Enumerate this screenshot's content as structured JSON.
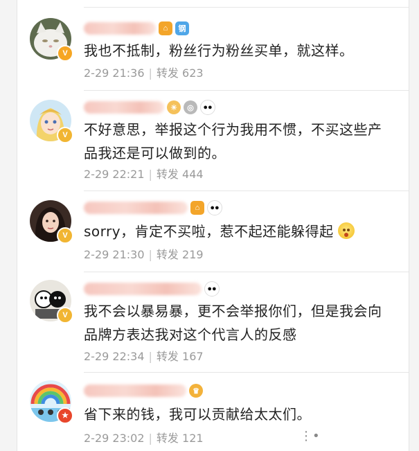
{
  "colors": {
    "verified_orange": "#f6a623",
    "verified_gold": "#f1b532",
    "verified_red": "#e8462b",
    "comment_text": "#222222",
    "meta_text": "#9a9a9a"
  },
  "comments": [
    {
      "avatar": "white-cat-avatar",
      "verified": "orange",
      "badges": [
        "home-badge-icon",
        "shield-badge-icon"
      ],
      "shield_text": "钢",
      "text": "我也不抵制，粉丝行为粉丝买单，就这样。",
      "date": "2-29 21:36",
      "repost_label": "转发",
      "repost_count": "623"
    },
    {
      "avatar": "anime-girl-avatar",
      "verified": "gold",
      "badges": [
        "sun-badge-icon",
        "medal-badge-icon",
        "panda-badge-icon"
      ],
      "text": "不好意思，举报这个行为我用不惯，不买这些产\n品我还是可以做到的。",
      "date": "2-29 22:21",
      "repost_label": "转发",
      "repost_count": "444"
    },
    {
      "avatar": "woman-portrait-avatar",
      "verified": "gold",
      "badges": [
        "home-badge-icon",
        "panda-badge-icon"
      ],
      "text": "sorry，肯定不买啦，惹不起还能躲得起",
      "emoji": "flushed-emoji",
      "date": "2-29 21:30",
      "repost_label": "转发",
      "repost_count": "219"
    },
    {
      "avatar": "cartoon-couple-avatar",
      "verified": "gold",
      "badges": [
        "panda-badge-icon"
      ],
      "text": "我不会以暴易暴，更不会举报你们，但是我会向\n品牌方表达我对这个代言人的反感",
      "date": "2-29 22:34",
      "repost_label": "转发",
      "repost_count": "167"
    },
    {
      "avatar": "rainbow-avatar",
      "verified": "red",
      "badges": [
        "crown-badge-icon"
      ],
      "text": "省下来的钱，我可以贡献给太太们。",
      "date": "2-29 23:02",
      "repost_label": "转发",
      "repost_count": "121"
    }
  ]
}
